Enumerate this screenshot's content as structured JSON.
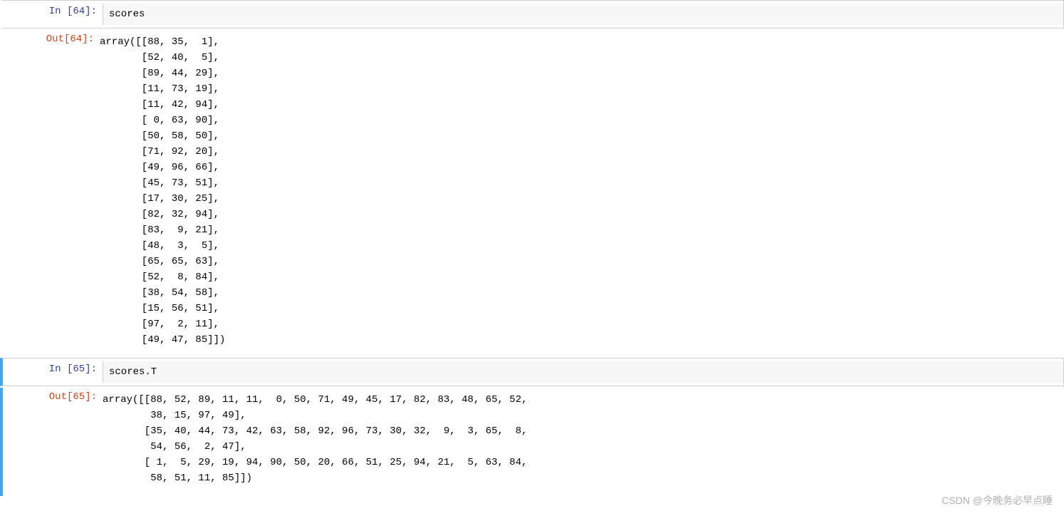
{
  "cells": {
    "c64": {
      "in_prompt": "In  [64]:",
      "out_prompt": "Out[64]:",
      "input": "scores",
      "output": "array([[88, 35,  1],\n       [52, 40,  5],\n       [89, 44, 29],\n       [11, 73, 19],\n       [11, 42, 94],\n       [ 0, 63, 90],\n       [50, 58, 50],\n       [71, 92, 20],\n       [49, 96, 66],\n       [45, 73, 51],\n       [17, 30, 25],\n       [82, 32, 94],\n       [83,  9, 21],\n       [48,  3,  5],\n       [65, 65, 63],\n       [52,  8, 84],\n       [38, 54, 58],\n       [15, 56, 51],\n       [97,  2, 11],\n       [49, 47, 85]])"
    },
    "c65": {
      "in_prompt": "In  [65]:",
      "out_prompt": "Out[65]:",
      "input": "scores.T",
      "output": "array([[88, 52, 89, 11, 11,  0, 50, 71, 49, 45, 17, 82, 83, 48, 65, 52,\n        38, 15, 97, 49],\n       [35, 40, 44, 73, 42, 63, 58, 92, 96, 73, 30, 32,  9,  3, 65,  8,\n        54, 56,  2, 47],\n       [ 1,  5, 29, 19, 94, 90, 50, 20, 66, 51, 25, 94, 21,  5, 63, 84,\n        58, 51, 11, 85]])"
    }
  },
  "watermark": "CSDN @今晚务必早点睡"
}
